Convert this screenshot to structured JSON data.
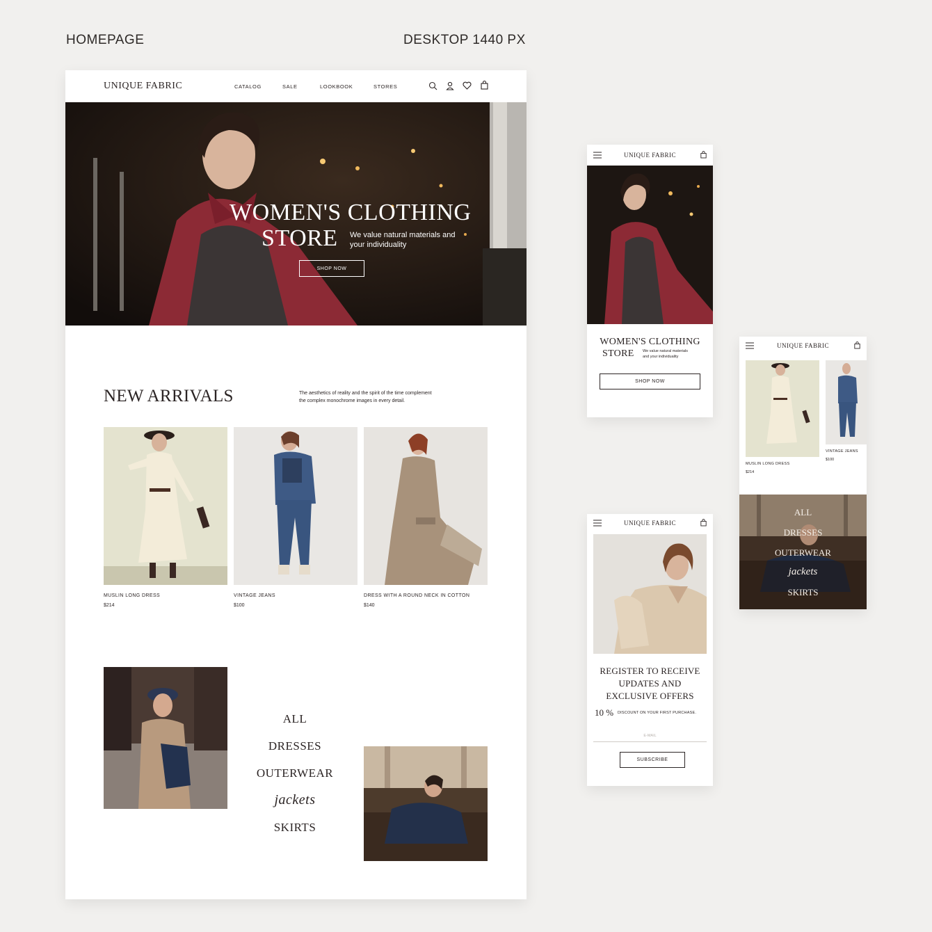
{
  "labels": {
    "homepage": "HOMEPAGE",
    "desktop": "DESKTOP 1440 PX"
  },
  "brand": "UNIQUE FABRIC",
  "nav": [
    "CATALOG",
    "SALE",
    "LOOKBOOK",
    "STORES"
  ],
  "icons": [
    "search-icon",
    "user-icon",
    "heart-icon",
    "bag-icon",
    "menu-icon"
  ],
  "hero": {
    "title_line1": "WOMEN'S CLOTHING",
    "title_line2": "STORE",
    "subtitle_line1": "We value natural materials and",
    "subtitle_line2": "your individuality",
    "cta": "SHOP NOW"
  },
  "arrivals": {
    "title": "NEW ARRIVALS",
    "desc_line1": "The aesthetics of reality and the spirit of the time complement",
    "desc_line2": "the complex monochrome images in every detail.",
    "products": [
      {
        "name": "MUSLIN LONG DRESS",
        "price": "$214"
      },
      {
        "name": "VINTAGE JEANS",
        "price": "$100"
      },
      {
        "name": "DRESS WITH A ROUND NECK IN COTTON",
        "price": "$140"
      }
    ]
  },
  "categories": [
    "ALL",
    "DRESSES",
    "OUTERWEAR",
    "jackets",
    "SKIRTS"
  ],
  "mobile_hero": {
    "title_line1": "WOMEN'S CLOTHING",
    "title_line2": "STORE",
    "subtitle_line1": "We value natural materials",
    "subtitle_line2": "and your individuality",
    "cta": "SHOP NOW"
  },
  "mobile_register": {
    "line1": "REGISTER TO RECEIVE",
    "line2": "UPDATES AND",
    "line3": "EXCLUSIVE OFFERS",
    "discount": "10 %",
    "discount_text": "DISCOUNT ON YOUR FIRST PURCHASE.",
    "email_placeholder": "E-MAIL",
    "subscribe": "SUBSCRIBE"
  },
  "colors": {
    "background": "#f1f0ee",
    "text": "#2b2424",
    "accent_red": "#8c2a35"
  }
}
